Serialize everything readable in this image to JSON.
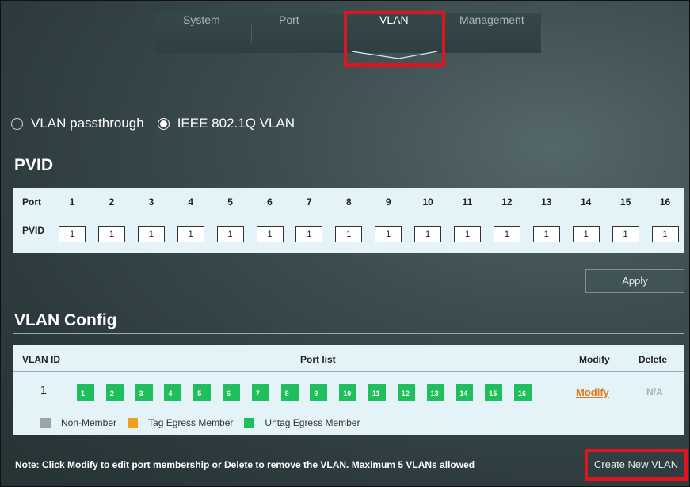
{
  "tabs": [
    {
      "label": "System"
    },
    {
      "label": "Port"
    },
    {
      "label": "VLAN"
    },
    {
      "label": "Management"
    }
  ],
  "active_tab": "VLAN",
  "vlan_mode": {
    "options": [
      {
        "label": "VLAN passthrough",
        "checked": false
      },
      {
        "label": "IEEE 802.1Q VLAN",
        "checked": true
      }
    ]
  },
  "pvid": {
    "title": "PVID",
    "port_label": "Port",
    "pvid_label": "PVID",
    "ports": [
      "1",
      "2",
      "3",
      "4",
      "5",
      "6",
      "7",
      "8",
      "9",
      "10",
      "11",
      "12",
      "13",
      "14",
      "15",
      "16"
    ],
    "values": [
      "1",
      "1",
      "1",
      "1",
      "1",
      "1",
      "1",
      "1",
      "1",
      "1",
      "1",
      "1",
      "1",
      "1",
      "1",
      "1"
    ],
    "apply_label": "Apply"
  },
  "vlan_config": {
    "title": "VLAN Config",
    "headers": {
      "vlan_id": "VLAN ID",
      "port_list": "Port list",
      "modify": "Modify",
      "delete": "Delete"
    },
    "rows": [
      {
        "vlan_id": "1",
        "ports": [
          "1",
          "2",
          "3",
          "4",
          "5",
          "6",
          "7",
          "8",
          "9",
          "10",
          "11",
          "12",
          "13",
          "14",
          "15",
          "16"
        ],
        "modify_label": "Modify",
        "delete_label": "N/A"
      }
    ],
    "legend": [
      {
        "label": "Non-Member",
        "color": "#9aa5a8"
      },
      {
        "label": "Tag Egress Member",
        "color": "#f0a020"
      },
      {
        "label": "Untag Egress Member",
        "color": "#1fbf5d"
      }
    ]
  },
  "note": "Note: Click Modify to edit port membership or Delete to remove the VLAN. Maximum 5 VLANs allowed",
  "create_label": "Create New VLAN",
  "colors": {
    "highlight": "#e0141e",
    "member": "#1fbf5d",
    "modify_link": "#e07a1a"
  }
}
